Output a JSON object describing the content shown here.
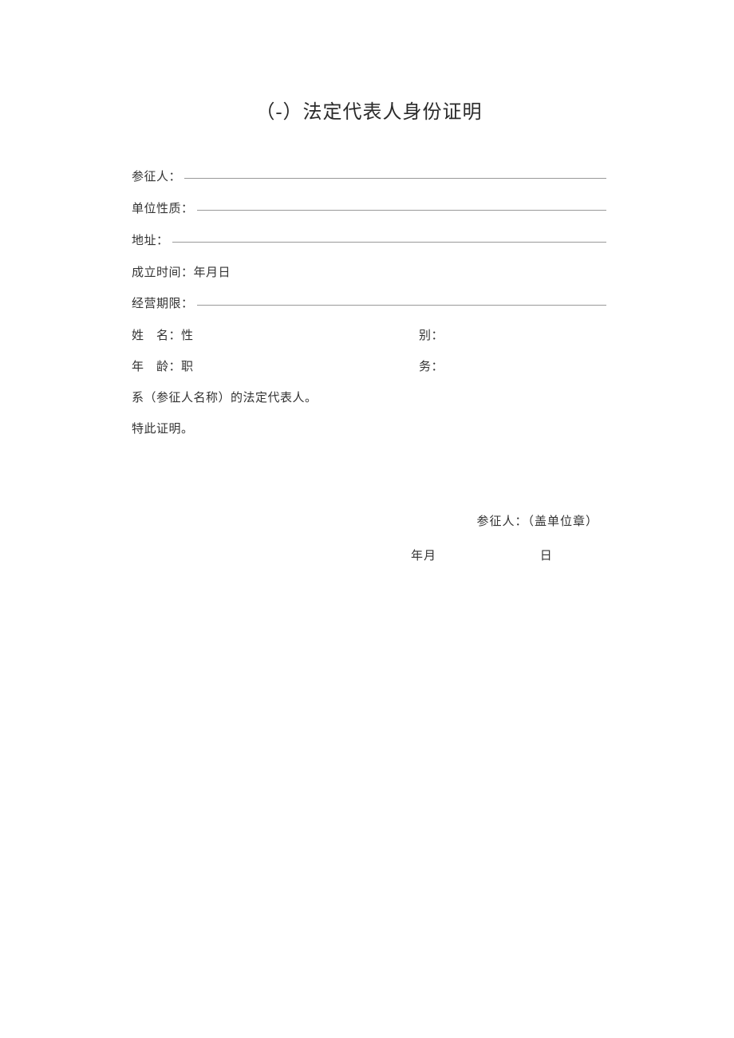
{
  "title": "（-）法定代表人身份证明",
  "fields": {
    "participant_label": "参征人：",
    "unit_nature_label": "单位性质：",
    "address_label": "地址：",
    "establish_date_label": "成立时间：",
    "establish_date_value": "年月日",
    "business_period_label": "经营期限：",
    "name_label": "姓 名：",
    "name_value": "性",
    "gender_label": "别：",
    "age_label": "年 龄：",
    "age_value": "职",
    "position_label": "务：",
    "statement_line": "系（参征人名称）的法定代表人。",
    "cert_line": "特此证明。"
  },
  "signature": {
    "participant": "参征人：",
    "seal": "（盖单位章）",
    "date_ym": "年月",
    "date_d": "日"
  }
}
